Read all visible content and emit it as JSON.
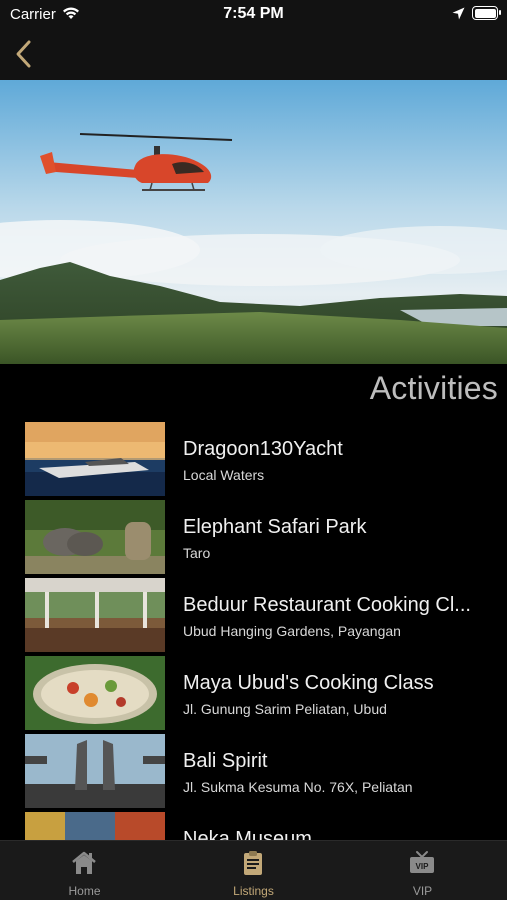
{
  "status_bar": {
    "carrier": "Carrier",
    "time": "7:54 PM"
  },
  "nav": {
    "back_icon": "chevron-left-icon",
    "accent_color": "#c2a878"
  },
  "hero": {
    "image": "helicopter flying over green mountains and clouds"
  },
  "section": {
    "title": "Activities"
  },
  "activities": [
    {
      "title": "Dragoon130Yacht",
      "subtitle": "Local Waters"
    },
    {
      "title": "Elephant Safari Park",
      "subtitle": "Taro"
    },
    {
      "title": "Beduur Restaurant Cooking Cl...",
      "subtitle": "Ubud Hanging Gardens, Payangan"
    },
    {
      "title": "Maya Ubud's Cooking Class",
      "subtitle": "Jl. Gunung Sarim Peliatan, Ubud"
    },
    {
      "title": "Bali Spirit",
      "subtitle": "Jl. Sukma Kesuma No. 76X, Peliatan"
    },
    {
      "title": "Neka Museum",
      "subtitle": ""
    }
  ],
  "tab_bar": {
    "tabs": [
      {
        "label": "Home",
        "icon": "house-icon",
        "active": false
      },
      {
        "label": "Listings",
        "icon": "clipboard-icon",
        "active": true
      },
      {
        "label": "VIP",
        "icon": "vip-tv-icon",
        "active": false
      }
    ]
  }
}
